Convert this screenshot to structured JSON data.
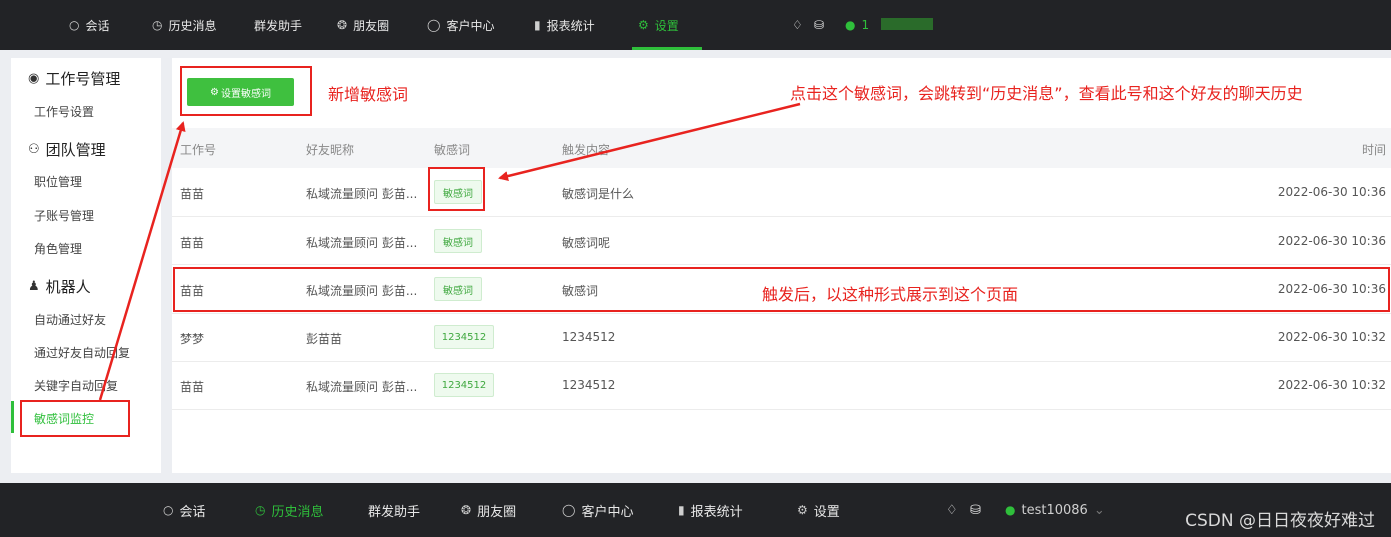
{
  "top_nav": {
    "items": [
      {
        "label": "会话",
        "icon": "chat-icon"
      },
      {
        "label": "历史消息",
        "icon": "clock-icon"
      },
      {
        "label": "群发助手",
        "icon": ""
      },
      {
        "label": "朋友圈",
        "icon": "aperture-icon"
      },
      {
        "label": "客户中心",
        "icon": "user-icon"
      },
      {
        "label": "报表统计",
        "icon": "bar-chart-icon"
      },
      {
        "label": "设置",
        "icon": "gear-icon"
      }
    ],
    "active": "设置",
    "user_label": "1"
  },
  "sidebar": {
    "groups": [
      {
        "title": "工作号管理",
        "icon": "wechat-icon",
        "items": [
          "工作号设置"
        ]
      },
      {
        "title": "团队管理",
        "icon": "team-icon",
        "items": [
          "职位管理",
          "子账号管理",
          "角色管理"
        ]
      },
      {
        "title": "机器人",
        "icon": "robot-icon",
        "items": [
          "自动通过好友",
          "通过好友自动回复",
          "关键字自动回复",
          "敏感词监控"
        ]
      }
    ],
    "active_item": "敏感词监控"
  },
  "main": {
    "set_button_label": "设置敏感词",
    "columns": [
      "工作号",
      "好友昵称",
      "敏感词",
      "触发内容",
      "时间"
    ],
    "rows": [
      {
        "account": "苗苗",
        "nickname": "私域流量顾问 彭苗...",
        "word": "敏感词",
        "content": "敏感词是什么",
        "time": "2022-06-30 10:36"
      },
      {
        "account": "苗苗",
        "nickname": "私域流量顾问 彭苗...",
        "word": "敏感词",
        "content": "敏感词呢",
        "time": "2022-06-30 10:36"
      },
      {
        "account": "苗苗",
        "nickname": "私域流量顾问 彭苗...",
        "word": "敏感词",
        "content": "敏感词",
        "time": "2022-06-30 10:36"
      },
      {
        "account": "梦梦",
        "nickname": "彭苗苗",
        "word": "1234512",
        "content": "1234512",
        "time": "2022-06-30 10:32"
      },
      {
        "account": "苗苗",
        "nickname": "私域流量顾问 彭苗...",
        "word": "1234512",
        "content": "1234512",
        "time": "2022-06-30 10:32"
      }
    ]
  },
  "annotations": {
    "new_word": "新增敏感词",
    "click_word": "点击这个敏感词，会跳转到“历史消息”，查看此号和这个好友的聊天历史",
    "after_trigger": "触发后，以这种形式展示到这个页面"
  },
  "bottom_nav": {
    "items": [
      {
        "label": "会话",
        "icon": "chat-icon"
      },
      {
        "label": "历史消息",
        "icon": "clock-icon"
      },
      {
        "label": "群发助手",
        "icon": ""
      },
      {
        "label": "朋友圈",
        "icon": "aperture-icon"
      },
      {
        "label": "客户中心",
        "icon": "user-icon"
      },
      {
        "label": "报表统计",
        "icon": "bar-chart-icon"
      },
      {
        "label": "设置",
        "icon": "gear-icon"
      }
    ],
    "active": "历史消息",
    "user_label": "test10086"
  },
  "watermark": "CSDN @日日夜夜好难过",
  "colors": {
    "accent": "#2fbf3b",
    "annotation": "#e8231f",
    "topbar": "#222326"
  }
}
